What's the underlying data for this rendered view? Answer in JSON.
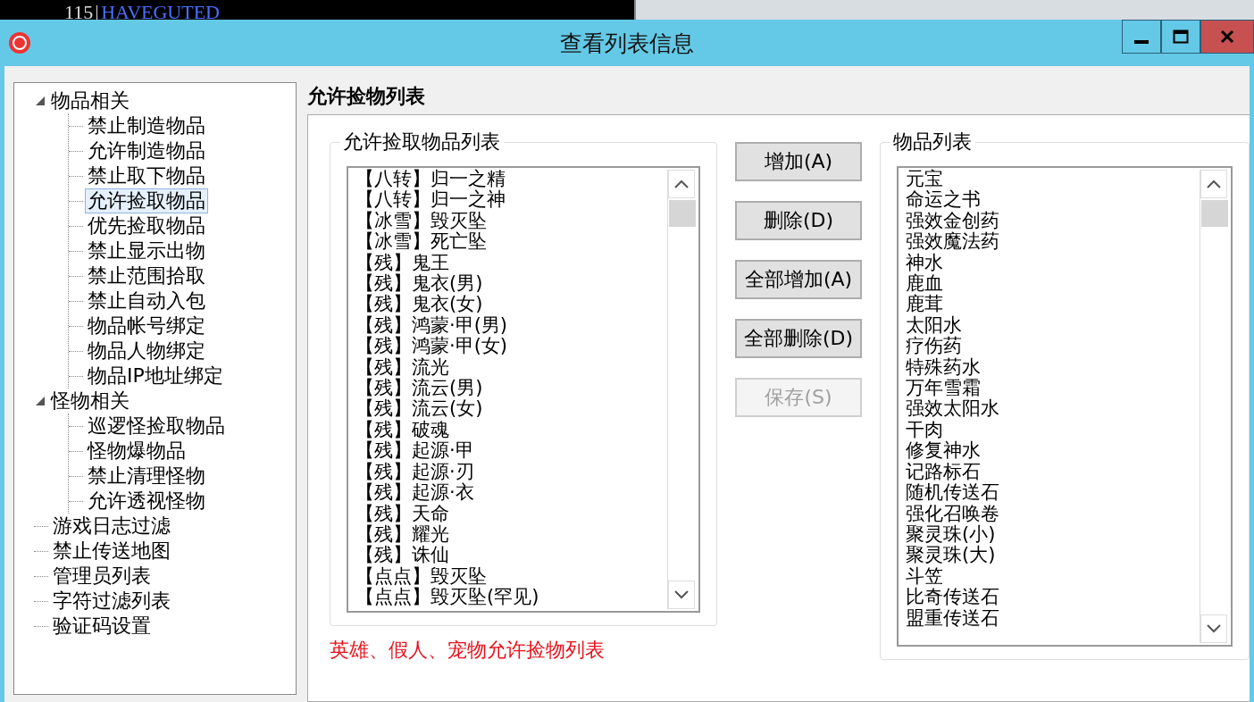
{
  "background_window": {
    "number": "115",
    "name": "HAVEGUTED"
  },
  "window": {
    "title": "查看列表信息"
  },
  "tree": [
    {
      "label": "物品相关",
      "expanded": true,
      "selected": false,
      "children": [
        {
          "label": "禁止制造物品",
          "selected": false
        },
        {
          "label": "允许制造物品",
          "selected": false
        },
        {
          "label": "禁止取下物品",
          "selected": false
        },
        {
          "label": "允许捡取物品",
          "selected": true
        },
        {
          "label": "优先捡取物品",
          "selected": false
        },
        {
          "label": "禁止显示出物",
          "selected": false
        },
        {
          "label": "禁止范围拾取",
          "selected": false
        },
        {
          "label": "禁止自动入包",
          "selected": false
        },
        {
          "label": "物品帐号绑定",
          "selected": false
        },
        {
          "label": "物品人物绑定",
          "selected": false
        },
        {
          "label": "物品IP地址绑定",
          "selected": false
        }
      ]
    },
    {
      "label": "怪物相关",
      "expanded": true,
      "selected": false,
      "children": [
        {
          "label": "巡逻怪捡取物品",
          "selected": false
        },
        {
          "label": "怪物爆物品",
          "selected": false
        },
        {
          "label": "禁止清理怪物",
          "selected": false
        },
        {
          "label": "允许透视怪物",
          "selected": false
        }
      ]
    },
    {
      "label": "游戏日志过滤",
      "selected": false
    },
    {
      "label": "禁止传送地图",
      "selected": false
    },
    {
      "label": "管理员列表",
      "selected": false
    },
    {
      "label": "字符过滤列表",
      "selected": false
    },
    {
      "label": "验证码设置",
      "selected": false
    }
  ],
  "panel_title": "允许捡物列表",
  "allowed_list": {
    "title": "允许捡取物品列表",
    "items": [
      "【八转】归一之精",
      "【八转】归一之神",
      "【冰雪】毁灭坠",
      "【冰雪】死亡坠",
      "【残】鬼王",
      "【残】鬼衣(男)",
      "【残】鬼衣(女)",
      "【残】鸿蒙·甲(男)",
      "【残】鸿蒙·甲(女)",
      "【残】流光",
      "【残】流云(男)",
      "【残】流云(女)",
      "【残】破魂",
      "【残】起源·甲",
      "【残】起源·刃",
      "【残】起源·衣",
      "【残】天命",
      "【残】耀光",
      "【残】诛仙",
      "【点点】毁灭坠",
      "【点点】毁灭坠(罕见)"
    ]
  },
  "buttons": [
    {
      "label": "增加(A)",
      "disabled": false
    },
    {
      "label": "删除(D)",
      "disabled": false
    },
    {
      "label": "全部增加(A)",
      "disabled": false
    },
    {
      "label": "全部删除(D)",
      "disabled": false
    },
    {
      "label": "保存(S)",
      "disabled": true
    }
  ],
  "note": "英雄、假人、宠物允许捡物列表",
  "item_list": {
    "title": "物品列表",
    "items": [
      "元宝",
      "命运之书",
      "强效金创药",
      "强效魔法药",
      "神水",
      "鹿血",
      "鹿茸",
      "太阳水",
      "疗伤药",
      "特殊药水",
      "万年雪霜",
      "强效太阳水",
      "干肉",
      "修复神水",
      "记路标石",
      "随机传送石",
      "强化召唤卷",
      "聚灵珠(小)",
      "聚灵珠(大)",
      "斗笠",
      "比奇传送石",
      "盟重传送石"
    ]
  }
}
